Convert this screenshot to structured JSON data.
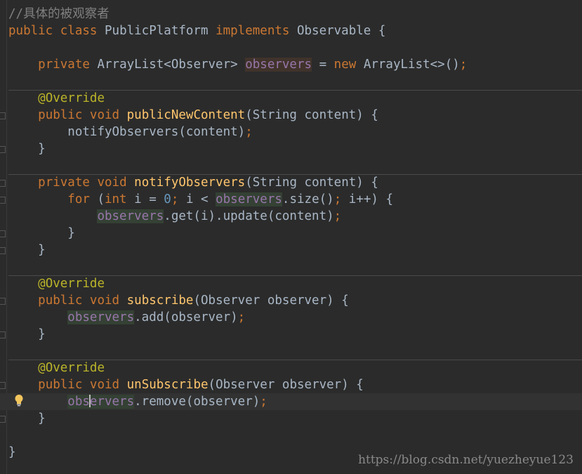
{
  "code": {
    "comment": "//具体的被观察者",
    "kw_public": "public",
    "kw_class": "class",
    "kw_private": "private",
    "kw_void": "void",
    "kw_implements": "implements",
    "kw_new": "new",
    "kw_for": "for",
    "kw_int": "int",
    "class_name": "PublicPlatform",
    "interface_name": "Observable",
    "type_arraylist": "ArrayList",
    "type_observer": "Observer",
    "type_string": "String",
    "field_observers": "observers",
    "annotation": "@Override",
    "method_public_new_content": "publicNewContent",
    "method_notify_observers": "notifyObservers",
    "method_subscribe": "subscribe",
    "method_unsubscribe": "unSubscribe",
    "param_content": "content",
    "param_observer": "observer",
    "var_i": "i",
    "num_zero": "0",
    "call_size": "size",
    "call_get": "get",
    "call_update": "update",
    "call_add": "add",
    "call_remove": "remove"
  },
  "watermark": "https://blog.csdn.net/yuezheyue123",
  "colors": {
    "background": "#2b2b2b",
    "keyword": "#cc7832",
    "method": "#ffc66d",
    "annotation": "#bbb529",
    "field": "#9876aa",
    "number": "#6897bb",
    "comment": "#808080",
    "text": "#a9b7c6"
  },
  "icons": {
    "intention": "lightbulb-icon"
  }
}
